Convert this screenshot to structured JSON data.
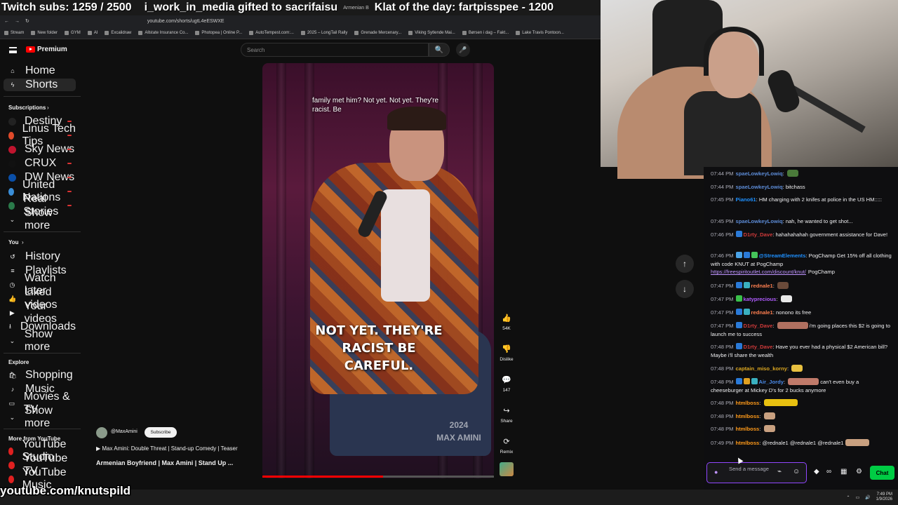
{
  "overlay": {
    "subs_goal": "Twitch subs: 1259 / 2500",
    "gift_ticker": "i_work_in_media gifted to sacrifaisu",
    "tiny_tab_text": "Armenian B",
    "klat": "Klat of the day: fartpisspee - 1200",
    "bottom_url": "youtube.com/knutspild"
  },
  "browser": {
    "url": "youtube.com/shorts/ugtL4eESWXE",
    "bookmarks": [
      "Stream",
      "New folder",
      "GYM",
      "AI",
      "Excalidraw",
      "Allstate Insurance Co...",
      "Photopea | Online P...",
      "AutoTempest.com:...",
      "2025 – LongTail Rally",
      "Grenade Mercenary...",
      "Viking Sytlende Mai...",
      "Børsen i dag – Fakt...",
      "Lake Travis Pontoon..."
    ]
  },
  "youtube": {
    "logo_text": "Premium",
    "search_placeholder": "Search",
    "nav": [
      {
        "label": "Home",
        "icon": "home-icon"
      },
      {
        "label": "Shorts",
        "icon": "shorts-icon"
      }
    ],
    "subscriptions_header": "Subscriptions",
    "subscriptions": [
      {
        "label": "Destiny",
        "color": "#222222"
      },
      {
        "label": "Linus Tech Tips",
        "color": "#e04a2a"
      },
      {
        "label": "Sky News",
        "color": "#c0142e"
      },
      {
        "label": "CRUX",
        "color": "#111111"
      },
      {
        "label": "DW News",
        "color": "#0a4fa8"
      },
      {
        "label": "United Nations",
        "color": "#3a8ed8"
      },
      {
        "label": "Real Stories",
        "color": "#2a7a4a"
      }
    ],
    "show_more": "Show more",
    "you_header": "You",
    "you_items": [
      {
        "label": "History",
        "icon": "history-icon"
      },
      {
        "label": "Playlists",
        "icon": "playlists-icon"
      },
      {
        "label": "Watch later",
        "icon": "watch-later-icon"
      },
      {
        "label": "Liked videos",
        "icon": "like-icon"
      },
      {
        "label": "Your videos",
        "icon": "your-videos-icon"
      },
      {
        "label": "Downloads",
        "icon": "download-icon"
      },
      {
        "label": "Show more",
        "icon": "chevron-down-icon"
      }
    ],
    "explore_header": "Explore",
    "explore_items": [
      {
        "label": "Shopping",
        "icon": "shopping-icon"
      },
      {
        "label": "Music",
        "icon": "music-icon"
      },
      {
        "label": "Movies & TV",
        "icon": "movies-icon"
      },
      {
        "label": "Show more",
        "icon": "chevron-down-icon"
      }
    ],
    "more_header": "More from YouTube",
    "more_items": [
      "YouTube Studio",
      "YouTube TV",
      "YouTube Music"
    ],
    "video": {
      "caption_top": "family met him? Not yet. Not yet. They're racist. Be",
      "caption_main": "NOT YET. THEY'RE RACIST BE CAREFUL.",
      "watermark_year": "2024",
      "watermark_name": "MAX AMINI",
      "progress": 0.52,
      "channel": "@MaxAmini",
      "subscribe_label": "Subscribe",
      "playlist": "▶ Max Amini: Double Threat | Stand-up Comedy | Teaser",
      "title": "Armenian Boyfriend | Max Amini | Stand Up ..."
    },
    "actions": [
      {
        "icon": "like-icon",
        "glyph": "👍",
        "label": "54K"
      },
      {
        "icon": "dislike-icon",
        "glyph": "👎",
        "label": "Dislike"
      },
      {
        "icon": "comment-icon",
        "glyph": "💬",
        "label": "147"
      },
      {
        "icon": "share-icon",
        "glyph": "↪",
        "label": "Share"
      },
      {
        "icon": "remix-icon",
        "glyph": "⟳",
        "label": "Remix"
      }
    ]
  },
  "chat": {
    "messages": [
      {
        "time": "07:44 PM",
        "user": "spaeLowkeyLowiq",
        "color": "#5c8bd6",
        "badges": [],
        "text": "",
        "emotes": [
          "#4a7a3a"
        ]
      },
      {
        "time": "07:44 PM",
        "user": "spaeLowkeyLowiq",
        "color": "#5c8bd6",
        "badges": [],
        "text": "bitchass",
        "emotes": []
      },
      {
        "time": "07:45 PM",
        "user": "Piano61",
        "color": "#1e90ff",
        "badges": [],
        "text": "HM charging with 2 knifes at police in the US HM:::::",
        "emotes": []
      },
      {
        "time": "07:45 PM",
        "user": "spaeLowkeyLowiq",
        "color": "#5c8bd6",
        "badges": [],
        "text": "nah, he wanted to get shot...",
        "emotes": []
      },
      {
        "time": "07:46 PM",
        "user": "D1rty_Dave",
        "color": "#d03a3a",
        "badges": [
          "#2a7ad8"
        ],
        "text": "hahahahahah government assistance for Dave!",
        "emotes": []
      },
      {
        "time": "07:46 PM",
        "user": "@StreamElements",
        "color": "#1e90ff",
        "badges": [
          "#4aa3e8",
          "#2a7ad8",
          "#45c45a"
        ],
        "text": "PogChamp Get 15% off all clothing with code KNUT at PogChamp",
        "link": "https://freespiritoutlet.com/discount/knut/",
        "after": "PogChamp",
        "emotes": []
      },
      {
        "time": "07:47 PM",
        "user": "rednale1",
        "color": "#ff7f50",
        "badges": [
          "#2a7ad8",
          "#3ab0c0"
        ],
        "text": "",
        "emotes": [
          "#6a4a3a"
        ]
      },
      {
        "time": "07:47 PM",
        "user": "katyprecious",
        "color": "#b05cff",
        "badges": [
          "#3ac04a"
        ],
        "text": "",
        "emotes": [
          "#e8e8e8"
        ]
      },
      {
        "time": "07:47 PM",
        "user": "rednale1",
        "color": "#ff7f50",
        "badges": [
          "#2a7ad8",
          "#3ab0c0"
        ],
        "text": "nonono its free",
        "emotes": []
      },
      {
        "time": "07:47 PM",
        "user": "D1rty_Dave",
        "color": "#d03a3a",
        "badges": [
          "#2a7ad8"
        ],
        "text": "i'm going places this $2 is going to launch me to success",
        "emotes": [
          "#b07060"
        ]
      },
      {
        "time": "07:48 PM",
        "user": "D1rty_Dave",
        "color": "#d03a3a",
        "badges": [
          "#2a7ad8"
        ],
        "text": "Have you ever had a physical $2 American bill? Maybe i'll share the wealth",
        "emotes": []
      },
      {
        "time": "07:48 PM",
        "user": "captain_miso_korny",
        "color": "#daa520",
        "badges": [],
        "text": "",
        "emotes": [
          "#e8c040"
        ]
      },
      {
        "time": "07:48 PM",
        "user": "Air_Jordy",
        "color": "#4a8ae8",
        "badges": [
          "#2a7ad8",
          "#e0a020",
          "#3ab0c0"
        ],
        "text": "can't even buy a cheeseburger at Mickey D's for 2 bucks anymore",
        "emotes": [
          "#c07a6a"
        ]
      },
      {
        "time": "07:48 PM",
        "user": "htmlboss",
        "color": "#ff9a1a",
        "badges": [],
        "text": "",
        "emotes": [
          "#e8c010"
        ]
      },
      {
        "time": "07:48 PM",
        "user": "htmlboss",
        "color": "#ff9a1a",
        "badges": [],
        "text": "",
        "emotes": [
          "#c8a080"
        ]
      },
      {
        "time": "07:48 PM",
        "user": "htmlboss",
        "color": "#ff9a1a",
        "badges": [],
        "text": "",
        "emotes": [
          "#c8a080"
        ]
      },
      {
        "time": "07:49 PM",
        "user": "htmlboss",
        "color": "#ff9a1a",
        "badges": [],
        "text": "@rednale1 @rednale1 @rednale1",
        "emotes": [
          "#c8a080"
        ]
      }
    ],
    "input_placeholder": "Send a message",
    "send_label": "Chat"
  },
  "taskbar": {
    "time": "7:49 PM",
    "date": "1/9/2026"
  }
}
